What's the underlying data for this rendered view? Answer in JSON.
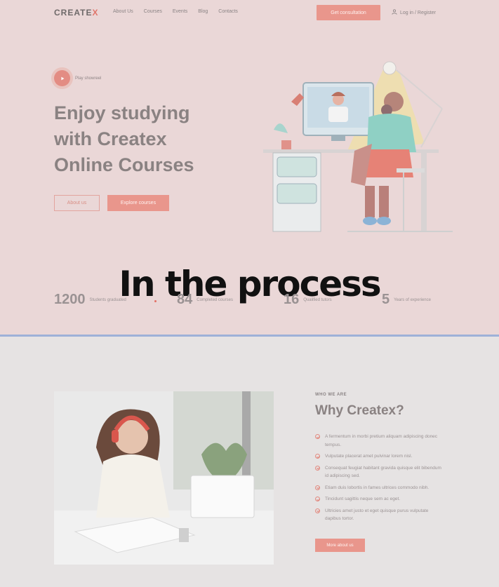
{
  "nav": {
    "logo_main": "CREATE",
    "logo_accent": "X",
    "menu": [
      "About Us",
      "Courses",
      "Events",
      "Blog",
      "Contacts"
    ],
    "cta": "Get consultation",
    "login": "Log in / Register"
  },
  "hero": {
    "play_label": "Play showreel",
    "headline": [
      "Enjoy studying",
      "with Createx",
      "Online Courses"
    ],
    "btn_about": "About us",
    "btn_explore": "Explore courses"
  },
  "overlay": {
    "text": "In the process"
  },
  "stats": [
    {
      "num": "1200",
      "label": "Students graduated"
    },
    {
      "num": "84",
      "label": "Completed courses"
    },
    {
      "num": "16",
      "label": "Qualified tutors"
    },
    {
      "num": "5",
      "label": "Years of experience"
    }
  ],
  "about": {
    "eyebrow": "WHO WE ARE",
    "title": "Why Createx?",
    "bullets": [
      "A fermentum in morbi pretium aliquam adipiscing donec tempus.",
      "Vulputate placerat amet pulvinar lorem nisl.",
      "Consequat feugiat habitant gravida quisque elit bibendum id adipiscing sed.",
      "Etiam duis lobortis in fames ultrices commodo nibh.",
      "Tincidunt sagittis neque sem ac eget.",
      "Ultricies amet justo et eget quisque purus vulputate dapibus tortor."
    ],
    "btn_more": "More about us"
  },
  "colors": {
    "hero_bg": "#ead7d7",
    "accent": "#e9968c",
    "text_gray": "#8a8282",
    "page_bg": "#e6e3e3"
  },
  "icons": [
    "user-icon",
    "play-icon",
    "check-circle-icon"
  ]
}
